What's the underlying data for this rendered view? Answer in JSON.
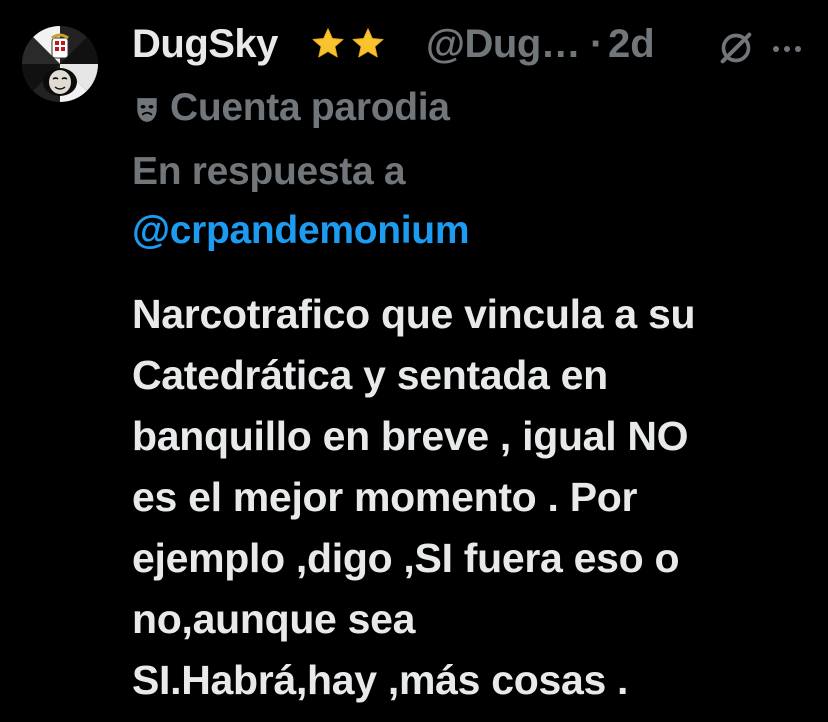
{
  "author": {
    "display_name": "DugSky",
    "badges": [
      "star-emoji",
      "star-emoji"
    ],
    "handle": "@Dug…",
    "separator": "·",
    "time": "2d",
    "parody_icon": "theater-mask-icon",
    "parody_label": "Cuenta parodia"
  },
  "actions": {
    "grok_icon": "grok-slash-icon",
    "more_icon": "more-dots-icon"
  },
  "reply": {
    "label": "En respuesta a",
    "to": "@crpandemonium"
  },
  "tweet": {
    "lines": [
      "Narcotrafico que vincula a su",
      "Catedrática y sentada en",
      "banquillo en breve , igual NO",
      "es el mejor momento . Por",
      "ejemplo ,digo ,SI fuera eso o",
      "no,aunque sea",
      "SI.Habrá,hay ,más cosas ."
    ]
  },
  "colors": {
    "background": "#000000",
    "primary_text": "#e7e9ea",
    "secondary_text": "#71767b",
    "link": "#1d9bf0",
    "star": "#f7c32e"
  }
}
